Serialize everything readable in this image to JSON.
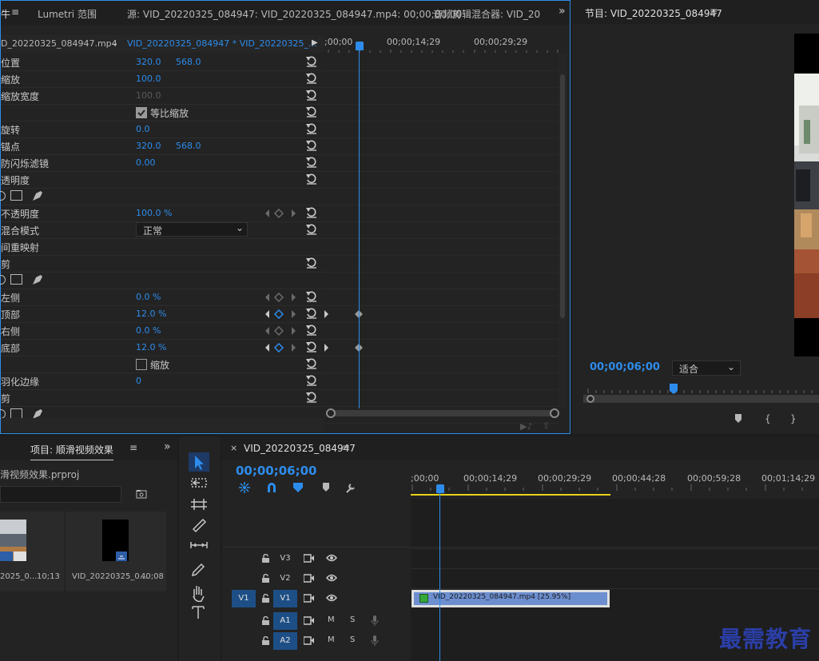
{
  "effect_controls": {
    "tab_partial": "牛",
    "tab_lumetri": "Lumetri 范围",
    "tab_source": "源: VID_20220325_084947: VID_20220325_084947.mp4: 00;00;00;00",
    "tab_audio_mixer": "音频剪辑混合器: VID_20",
    "clip_master": "D_20220325_084947.mp4",
    "clip_sequence": "VID_20220325_084947 * VID_20220325_...",
    "tl_time_start": ";00;00",
    "tl_time_mid": "00;00;14;29",
    "tl_time_end": "00;00;29;29",
    "rows": [
      {
        "label": "位置",
        "v1": "320.0",
        "v2": "568.0",
        "reset": true
      },
      {
        "label": "缩放",
        "v1": "100.0",
        "reset": true
      },
      {
        "label": "缩放宽度",
        "v1": "100.0",
        "dim": true,
        "reset": true
      },
      {
        "label": "",
        "checkbox": "等比缩放",
        "checked": true,
        "reset": true
      },
      {
        "label": "旋转",
        "v1": "0.0",
        "reset": true
      },
      {
        "label": "锚点",
        "v1": "320.0",
        "v2": "568.0",
        "reset": true
      },
      {
        "label": "防闪烁滤镜",
        "v1": "0.00",
        "reset": true
      },
      {
        "label": "透明度",
        "reset": true
      },
      {
        "label": "",
        "mask_tools": true
      },
      {
        "label": "不透明度",
        "v1": "100.0 %",
        "kf": true,
        "reset": true
      },
      {
        "label": "混合模式",
        "select": "正常",
        "reset": true
      },
      {
        "label": "间重映射"
      },
      {
        "label": "剪",
        "reset": true
      },
      {
        "label": "",
        "mask_tools": true
      },
      {
        "label": "左侧",
        "v1": "0.0 %",
        "kf": true,
        "reset": true
      },
      {
        "label": "顶部",
        "v1": "12.0 %",
        "kf": true,
        "active": true,
        "reset": true
      },
      {
        "label": "右侧",
        "v1": "0.0 %",
        "kf": true,
        "reset": true
      },
      {
        "label": "底部",
        "v1": "12.0 %",
        "kf": true,
        "active": true,
        "reset": true
      },
      {
        "label": "",
        "checkbox": "缩放",
        "checked": false,
        "reset": true
      },
      {
        "label": "羽化边缘",
        "v1": "0",
        "reset": true
      },
      {
        "label": "剪",
        "reset": true
      },
      {
        "label": "",
        "mask_tools": true
      }
    ]
  },
  "program_monitor": {
    "title": "节目: VID_20220325_084947",
    "timecode": "00;00;06;00",
    "fit": "适合"
  },
  "project": {
    "title": "项目: 顺滑视频效果",
    "file": "滑视频效果.prproj",
    "items": [
      {
        "name": "2025_0...",
        "duration": "10;13"
      },
      {
        "name": "VID_20220325_0...",
        "duration": "40;08"
      }
    ]
  },
  "timeline": {
    "sequence": "VID_20220325_084947",
    "timecode": "00;00;06;00",
    "ruler": [
      ";00;00",
      "00;00;14;29",
      "00;00;29;29",
      "00;00;44;28",
      "00;00;59;28",
      "00;01;14;29"
    ],
    "tracks": [
      {
        "name": "V3",
        "src": "",
        "type": "video"
      },
      {
        "name": "V2",
        "src": "",
        "type": "video"
      },
      {
        "name": "V1",
        "src": "V1",
        "type": "video",
        "target": true
      },
      {
        "name": "A1",
        "src": "",
        "type": "audio",
        "target": true
      },
      {
        "name": "A2",
        "src": "",
        "type": "audio",
        "target": true
      }
    ],
    "clip_label": "VID_20220325_084947.mp4 [25.95%]",
    "mute": "M",
    "solo": "S"
  },
  "watermark": "最需教育",
  "colors": {
    "accent": "#2d8ceb",
    "clip": "#6d8fd0",
    "workarea": "#e8d319"
  }
}
